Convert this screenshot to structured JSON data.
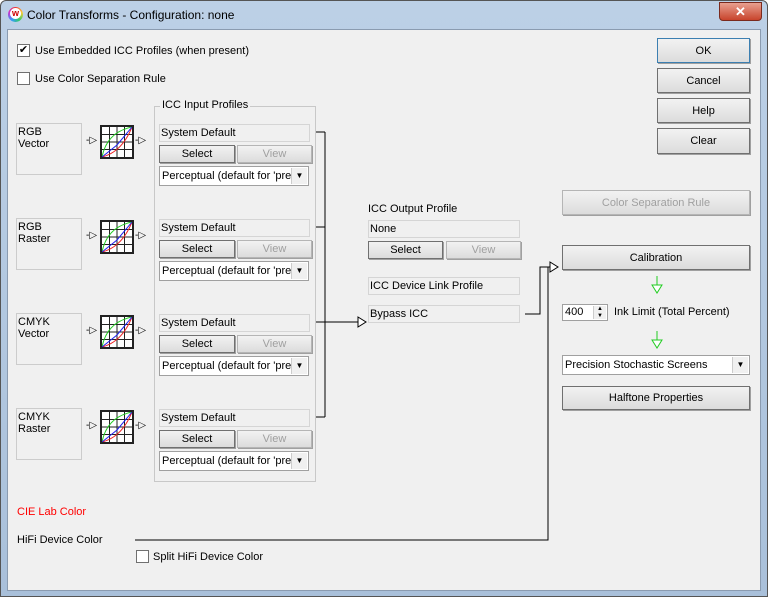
{
  "window": {
    "title": "Color Transforms - Configuration: none",
    "close": "✕"
  },
  "options": {
    "embedded": {
      "label": "Use Embedded ICC Profiles (when present)",
      "checked": true
    },
    "separation": {
      "label": "Use Color Separation Rule",
      "checked": false
    }
  },
  "buttons": {
    "ok": "OK",
    "cancel": "Cancel",
    "help": "Help",
    "clear": "Clear"
  },
  "input_group": {
    "title": "ICC Input Profiles"
  },
  "inputs": [
    {
      "source": "RGB\nVector",
      "profile": "System Default",
      "select": "Select",
      "view": "View",
      "intent": "Perceptual (default for 'pretty"
    },
    {
      "source": "RGB\nRaster",
      "profile": "System Default",
      "select": "Select",
      "view": "View",
      "intent": "Perceptual (default for 'pretty"
    },
    {
      "source": "CMYK\nVector",
      "profile": "System Default",
      "select": "Select",
      "view": "View",
      "intent": "Perceptual (default for 'pretty"
    },
    {
      "source": "CMYK\nRaster",
      "profile": "System Default",
      "select": "Select",
      "view": "View",
      "intent": "Perceptual (default for 'pretty"
    }
  ],
  "output": {
    "label": "ICC Output Profile",
    "profile": "None",
    "select": "Select",
    "view": "View",
    "devicelink_label": "ICC Device Link Profile",
    "devicelink": "Bypass ICC"
  },
  "right": {
    "color_sep_rule": "Color Separation Rule",
    "calibration": "Calibration",
    "ink_limit_value": "400",
    "ink_limit_label": "Ink Limit (Total Percent)",
    "screen": "Precision Stochastic Screens",
    "halftone": "Halftone Properties"
  },
  "bottom": {
    "cie_lab": "CIE Lab Color",
    "hifi": "HiFi Device Color",
    "split_hifi": {
      "label": "Split HiFi Device Color",
      "checked": false
    }
  },
  "colors": {
    "cie_lab": "#ff0000",
    "flow_arrow": "#22cc22"
  }
}
